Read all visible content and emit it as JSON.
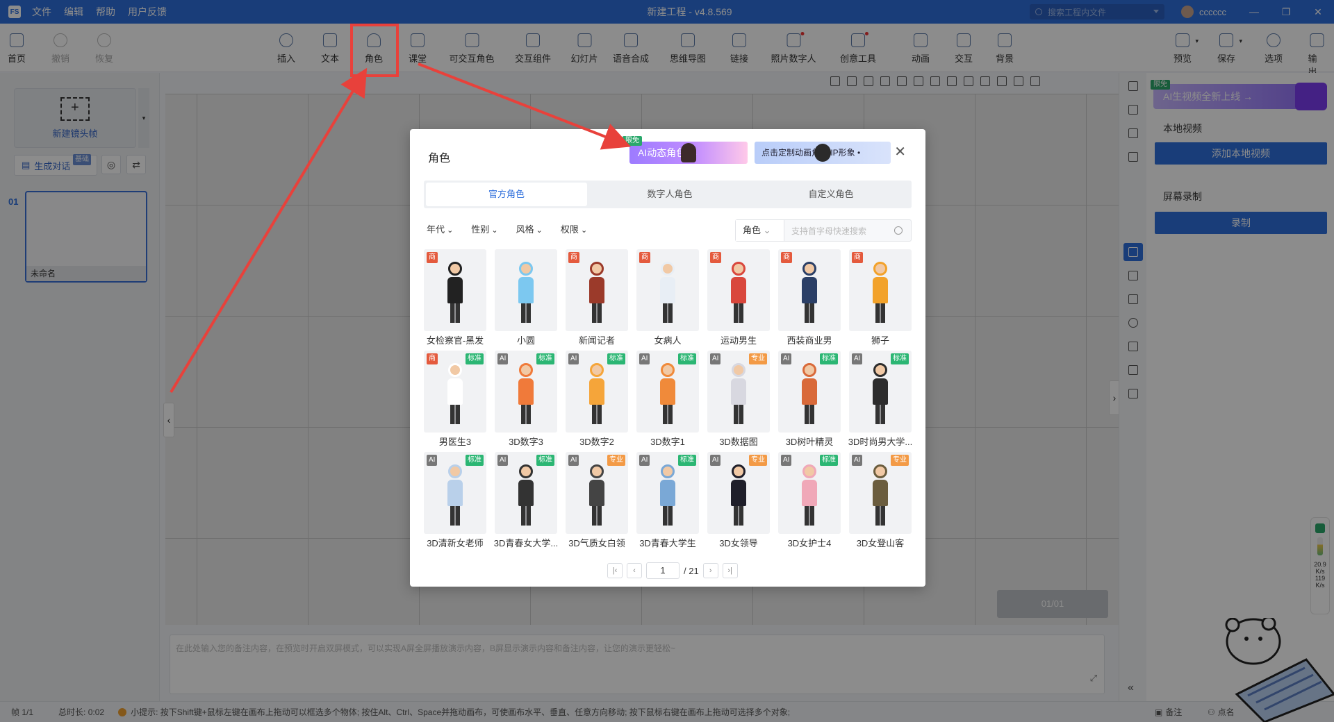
{
  "app": {
    "logo": "FS",
    "window_title": "新建工程 - v4.8.569",
    "menu": [
      "文件",
      "编辑",
      "帮助",
      "用户反馈"
    ],
    "search_placeholder": "搜索工程内文件",
    "username": "cccccc"
  },
  "toolbar": {
    "left": [
      {
        "label": "首页",
        "icon": "home-icon"
      },
      {
        "label": "撤销",
        "icon": "undo-icon"
      },
      {
        "label": "恢复",
        "icon": "redo-icon"
      }
    ],
    "center": [
      {
        "label": "插入",
        "icon": "plus-circle-icon"
      },
      {
        "label": "文本",
        "icon": "text-icon"
      },
      {
        "label": "角色",
        "icon": "person-icon"
      },
      {
        "label": "课堂",
        "icon": "classroom-icon"
      },
      {
        "label": "可交互角色",
        "icon": "interactive-person-icon"
      },
      {
        "label": "交互组件",
        "icon": "component-icon"
      },
      {
        "label": "幻灯片",
        "icon": "slides-icon"
      },
      {
        "label": "语音合成",
        "icon": "voice-icon"
      },
      {
        "label": "思维导图",
        "icon": "mindmap-icon"
      },
      {
        "label": "链接",
        "icon": "link-icon"
      },
      {
        "label": "照片数字人",
        "icon": "photo-avatar-icon"
      },
      {
        "label": "创意工具",
        "icon": "creative-icon"
      },
      {
        "label": "动画",
        "icon": "animation-icon"
      },
      {
        "label": "交互",
        "icon": "interaction-icon"
      },
      {
        "label": "背景",
        "icon": "background-icon"
      }
    ],
    "right": [
      {
        "label": "预览",
        "icon": "preview-icon"
      },
      {
        "label": "保存",
        "icon": "save-icon"
      },
      {
        "label": "选项",
        "icon": "options-icon"
      },
      {
        "label": "输出",
        "icon": "export-icon"
      }
    ]
  },
  "left_panel": {
    "new_shot": "新建镜头帧",
    "gen_dialog": "生成对话",
    "gen_badge": "基础",
    "frame_number": "01",
    "frame_name": "未命名"
  },
  "notes_placeholder": "在此处输入您的备注内容，在预览时开启双屏模式，可以实现A屏全屏播放演示内容，B屏显示演示内容和备注内容，让您的演示更轻松~",
  "player_counter": "01/01",
  "right_panel": {
    "ai_tag": "限免",
    "ai_banner": "AI生视频全新上线 →",
    "local_video_label": "本地视频",
    "add_local_video": "添加本地视频",
    "screen_record_label": "屏幕录制",
    "record_button": "录制"
  },
  "status": {
    "frame": "帧 1/1",
    "duration": "总时长: 0:02",
    "tip": "小提示: 按下Shift键+鼠标左键在画布上拖动可以框选多个物体; 按住Alt、Ctrl、Space并拖动画布，可使画布水平、垂直、任意方向移动; 按下鼠标右键在画布上拖动可选择多个对象;",
    "notes": "备注",
    "rollcall": "点名"
  },
  "widget": {
    "speed1": "20.9",
    "unit1": "K/s",
    "speed2": "119",
    "unit2": "K/s"
  },
  "modal": {
    "title": "角色",
    "banner1_tag": "限免",
    "banner1": "AI动态角色 →",
    "banner2": "点击定制动画角色/IP形象 •",
    "tabs": [
      "官方角色",
      "数字人角色",
      "自定义角色"
    ],
    "filters": [
      "年代",
      "性别",
      "风格",
      "权限"
    ],
    "search_category": "角色",
    "search_placeholder": "支持首字母快速搜索",
    "characters": [
      {
        "name": "女检察官-黑发",
        "tags": [
          "商"
        ]
      },
      {
        "name": "小圆",
        "tags": []
      },
      {
        "name": "新闻记者",
        "tags": [
          "商"
        ]
      },
      {
        "name": "女病人",
        "tags": [
          "商"
        ]
      },
      {
        "name": "运动男生",
        "tags": [
          "商"
        ]
      },
      {
        "name": "西装商业男",
        "tags": [
          "商"
        ]
      },
      {
        "name": "狮子",
        "tags": [
          "商"
        ]
      },
      {
        "name": "男医生3",
        "tags": [
          "商",
          "标准"
        ]
      },
      {
        "name": "3D数字3",
        "tags": [
          "AI",
          "标准"
        ]
      },
      {
        "name": "3D数字2",
        "tags": [
          "AI",
          "标准"
        ]
      },
      {
        "name": "3D数字1",
        "tags": [
          "AI",
          "标准"
        ]
      },
      {
        "name": "3D数据图",
        "tags": [
          "AI",
          "专业"
        ]
      },
      {
        "name": "3D树叶精灵",
        "tags": [
          "AI",
          "标准"
        ]
      },
      {
        "name": "3D时尚男大学...",
        "tags": [
          "AI",
          "标准"
        ]
      },
      {
        "name": "3D清新女老师",
        "tags": [
          "AI",
          "标准"
        ]
      },
      {
        "name": "3D青春女大学...",
        "tags": [
          "AI",
          "标准"
        ]
      },
      {
        "name": "3D气质女白领",
        "tags": [
          "AI",
          "专业"
        ]
      },
      {
        "name": "3D青春大学生",
        "tags": [
          "AI",
          "标准"
        ]
      },
      {
        "name": "3D女领导",
        "tags": [
          "AI",
          "专业"
        ]
      },
      {
        "name": "3D女护士4",
        "tags": [
          "AI",
          "标准"
        ]
      },
      {
        "name": "3D女登山客",
        "tags": [
          "AI",
          "专业"
        ]
      }
    ],
    "page_current": "1",
    "page_total": "/ 21"
  }
}
